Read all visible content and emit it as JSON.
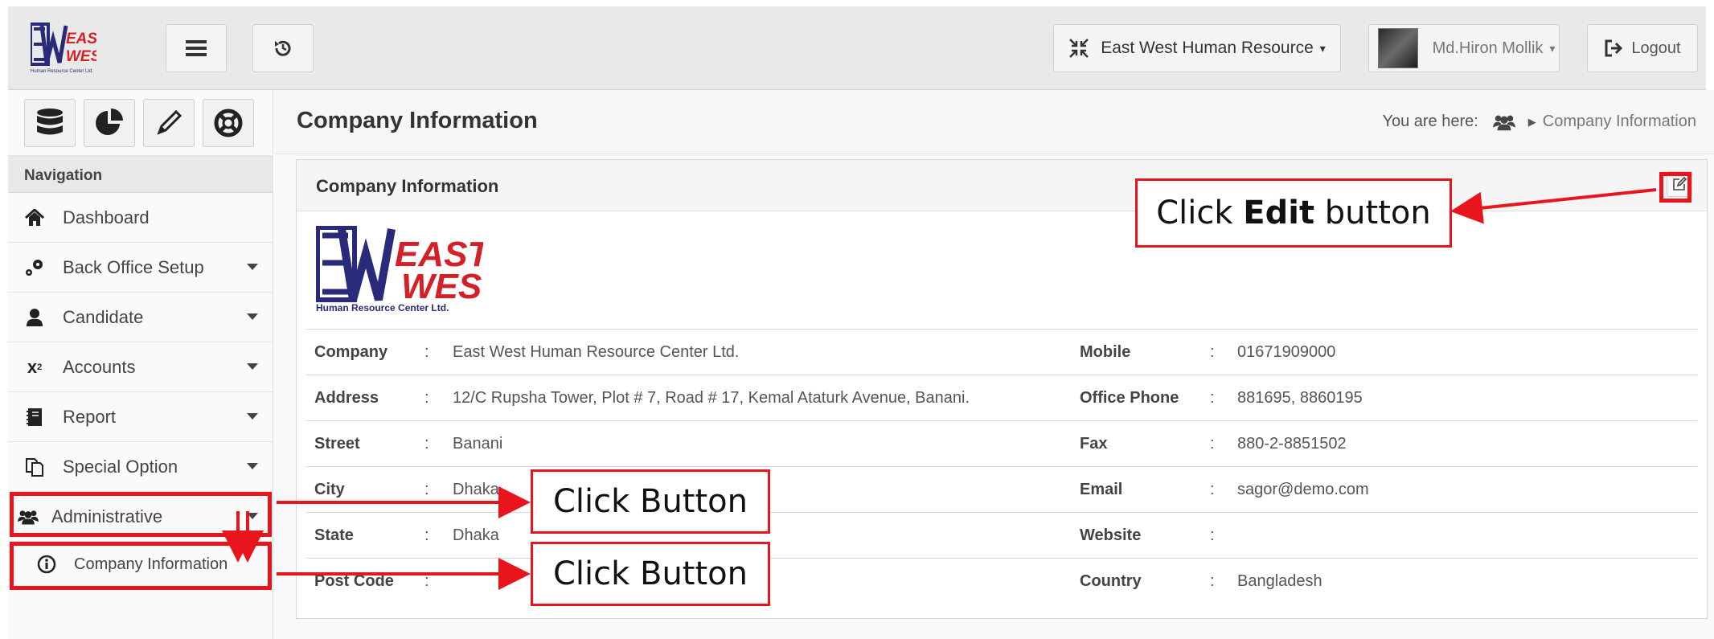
{
  "topbar": {
    "company_menu_label": "East West Human Resource",
    "user_menu_label": "Md.Hiron Mollik",
    "logout_label": "Logout",
    "logo_text_1": "EAST",
    "logo_text_2": "WEST",
    "logo_subtext": "Human Resource Center Ltd."
  },
  "sidebar": {
    "nav_heading": "Navigation",
    "items": [
      {
        "label": "Dashboard",
        "icon": "home-icon"
      },
      {
        "label": "Back Office Setup",
        "icon": "gears-icon"
      },
      {
        "label": "Candidate",
        "icon": "user-icon"
      },
      {
        "label": "Accounts",
        "icon": "superscript-icon"
      },
      {
        "label": "Report",
        "icon": "book-icon"
      },
      {
        "label": "Special Option",
        "icon": "files-icon"
      },
      {
        "label": "Administrative",
        "icon": "users-icon"
      }
    ],
    "sub_item": {
      "label": "Company Information",
      "icon": "info-circle-icon"
    }
  },
  "header": {
    "title": "Company Information",
    "breadcrumb_prefix": "You are here:",
    "breadcrumb_current": "Company Information"
  },
  "panel": {
    "title": "Company Information",
    "logo_text_1": "EAST",
    "logo_text_2": "WEST",
    "logo_subtext": "Human Resource Center Ltd.",
    "separator": ":",
    "rows": [
      {
        "left_label": "Company",
        "left_value": "East West Human Resource Center Ltd.",
        "right_label": "Mobile",
        "right_value": "01671909000"
      },
      {
        "left_label": "Address",
        "left_value": "12/C Rupsha Tower, Plot # 7, Road # 17, Kemal Ataturk Avenue, Banani.",
        "right_label": "Office Phone",
        "right_value": "881695, 8860195"
      },
      {
        "left_label": "Street",
        "left_value": "Banani",
        "right_label": "Fax",
        "right_value": "880-2-8851502"
      },
      {
        "left_label": "City",
        "left_value": "Dhaka",
        "right_label": "Email",
        "right_value": "sagor@demo.com"
      },
      {
        "left_label": "State",
        "left_value": "Dhaka",
        "right_label": "Website",
        "right_value": ""
      },
      {
        "left_label": "Post Code",
        "left_value": "",
        "right_label": "Country",
        "right_value": "Bangladesh"
      }
    ]
  },
  "annotations": {
    "edit_prefix": "Click ",
    "edit_bold": "Edit",
    "edit_suffix": " button",
    "click_button_1": "Click Button",
    "click_button_2": "Click Button"
  },
  "colors": {
    "annotation_red": "#e8161c",
    "logo_blue": "#2a2a7a",
    "logo_red": "#d42027"
  }
}
